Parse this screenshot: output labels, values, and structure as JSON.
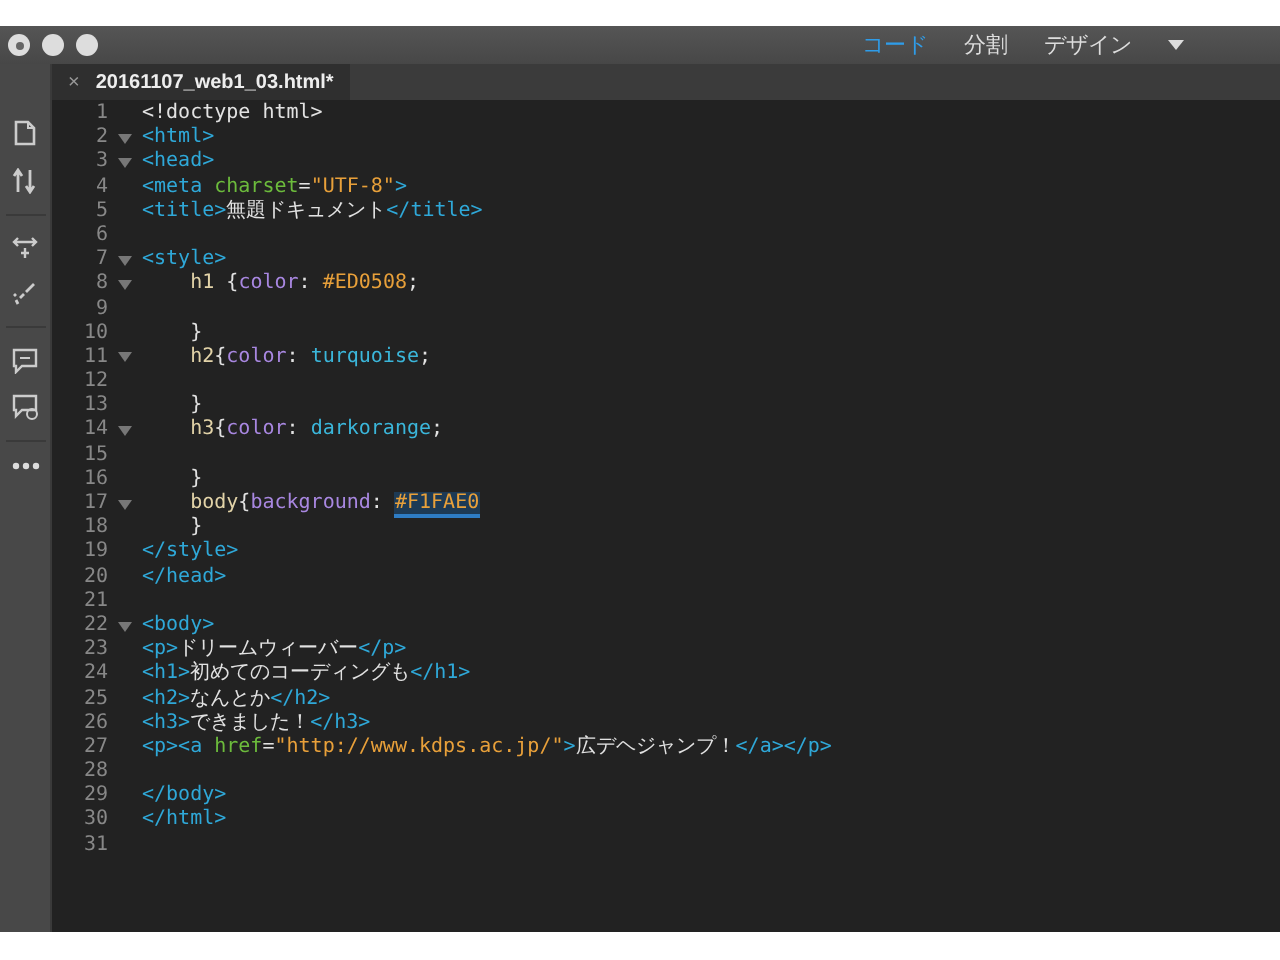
{
  "view_switcher": [
    {
      "label": "コード",
      "selected": true
    },
    {
      "label": "分割",
      "selected": false
    },
    {
      "label": "デザイン",
      "selected": false
    }
  ],
  "file_tab": {
    "close": "×",
    "title": "20161107_web1_03.html*"
  },
  "code_lines": [
    {
      "number": "1",
      "foldable": false,
      "tokens": [
        {
          "kind": "text",
          "text": "<!doctype html>"
        }
      ]
    },
    {
      "number": "2",
      "foldable": true,
      "tokens": [
        {
          "kind": "tag",
          "text": "<html>"
        }
      ]
    },
    {
      "number": "3",
      "foldable": true,
      "tokens": [
        {
          "kind": "tag",
          "text": "<head>"
        }
      ]
    },
    {
      "number": "4",
      "foldable": false,
      "tokens": [
        {
          "kind": "tag",
          "text": "<meta "
        },
        {
          "kind": "attr",
          "text": "charset"
        },
        {
          "kind": "text",
          "text": "="
        },
        {
          "kind": "string",
          "text": "\"UTF-8\""
        },
        {
          "kind": "tag",
          "text": ">"
        }
      ]
    },
    {
      "number": "5",
      "foldable": false,
      "tokens": [
        {
          "kind": "tag",
          "text": "<title>"
        },
        {
          "kind": "text",
          "text": "無題ドキュメント"
        },
        {
          "kind": "tag",
          "text": "</title>"
        }
      ]
    },
    {
      "number": "6",
      "foldable": false
    },
    {
      "number": "7",
      "foldable": true,
      "tokens": [
        {
          "kind": "tag",
          "text": "<style>"
        }
      ]
    },
    {
      "number": "8",
      "foldable": true,
      "tokens": [
        {
          "kind": "selector",
          "text": "    h1 "
        },
        {
          "kind": "text",
          "text": "{"
        },
        {
          "kind": "property",
          "text": "color"
        },
        {
          "kind": "text",
          "text": ": "
        },
        {
          "kind": "hex",
          "text": "#ED0508"
        },
        {
          "kind": "text",
          "text": ";"
        }
      ]
    },
    {
      "number": "9",
      "foldable": false
    },
    {
      "number": "10",
      "foldable": false,
      "tokens": [
        {
          "kind": "text",
          "text": "    }"
        }
      ]
    },
    {
      "number": "11",
      "foldable": true,
      "tokens": [
        {
          "kind": "selector",
          "text": "    h2"
        },
        {
          "kind": "text",
          "text": "{"
        },
        {
          "kind": "property",
          "text": "color"
        },
        {
          "kind": "text",
          "text": ": "
        },
        {
          "kind": "keyword",
          "text": "turquoise"
        },
        {
          "kind": "text",
          "text": ";"
        }
      ]
    },
    {
      "number": "12",
      "foldable": false
    },
    {
      "number": "13",
      "foldable": false,
      "tokens": [
        {
          "kind": "text",
          "text": "    }"
        }
      ]
    },
    {
      "number": "14",
      "foldable": true,
      "tokens": [
        {
          "kind": "selector",
          "text": "    h3"
        },
        {
          "kind": "text",
          "text": "{"
        },
        {
          "kind": "property",
          "text": "color"
        },
        {
          "kind": "text",
          "text": ": "
        },
        {
          "kind": "keyword",
          "text": "darkorange"
        },
        {
          "kind": "text",
          "text": ";"
        }
      ]
    },
    {
      "number": "15",
      "foldable": false
    },
    {
      "number": "16",
      "foldable": false,
      "tokens": [
        {
          "kind": "text",
          "text": "    }"
        }
      ]
    },
    {
      "number": "17",
      "foldable": true,
      "tokens": [
        {
          "kind": "selector",
          "text": "    body"
        },
        {
          "kind": "text",
          "text": "{"
        },
        {
          "kind": "property",
          "text": "background"
        },
        {
          "kind": "text",
          "text": ": "
        },
        {
          "kind": "hex-highlighted",
          "text": "#F1FAE0"
        }
      ]
    },
    {
      "number": "18",
      "foldable": false,
      "tokens": [
        {
          "kind": "text",
          "text": "    }"
        }
      ]
    },
    {
      "number": "19",
      "foldable": false,
      "tokens": [
        {
          "kind": "tag",
          "text": "</style>"
        }
      ]
    },
    {
      "number": "20",
      "foldable": false,
      "tokens": [
        {
          "kind": "tag",
          "text": "</head>"
        }
      ]
    },
    {
      "number": "21",
      "foldable": false
    },
    {
      "number": "22",
      "foldable": true,
      "tokens": [
        {
          "kind": "tag",
          "text": "<body>"
        }
      ]
    },
    {
      "number": "23",
      "foldable": false,
      "tokens": [
        {
          "kind": "tag",
          "text": "<p>"
        },
        {
          "kind": "text",
          "text": "ドリームウィーバー"
        },
        {
          "kind": "tag",
          "text": "</p>"
        }
      ]
    },
    {
      "number": "24",
      "foldable": false,
      "tokens": [
        {
          "kind": "tag",
          "text": "<h1>"
        },
        {
          "kind": "text",
          "text": "初めてのコーディングも"
        },
        {
          "kind": "tag",
          "text": "</h1>"
        }
      ]
    },
    {
      "number": "25",
      "foldable": false,
      "tokens": [
        {
          "kind": "tag",
          "text": "<h2>"
        },
        {
          "kind": "text",
          "text": "なんとか"
        },
        {
          "kind": "tag",
          "text": "</h2>"
        }
      ]
    },
    {
      "number": "26",
      "foldable": false,
      "tokens": [
        {
          "kind": "tag",
          "text": "<h3>"
        },
        {
          "kind": "text",
          "text": "できました！"
        },
        {
          "kind": "tag",
          "text": "</h3>"
        }
      ]
    },
    {
      "number": "27",
      "foldable": false,
      "tokens": [
        {
          "kind": "tag",
          "text": "<p><a "
        },
        {
          "kind": "attr",
          "text": "href"
        },
        {
          "kind": "text",
          "text": "="
        },
        {
          "kind": "string",
          "text": "\"http://www.kdps.ac.jp/\""
        },
        {
          "kind": "tag",
          "text": ">"
        },
        {
          "kind": "text",
          "text": "広デヘジャンプ！"
        },
        {
          "kind": "tag",
          "text": "</a></p>"
        }
      ]
    },
    {
      "number": "28",
      "foldable": false
    },
    {
      "number": "29",
      "foldable": false,
      "tokens": [
        {
          "kind": "tag",
          "text": "</body>"
        }
      ]
    },
    {
      "number": "30",
      "foldable": false,
      "tokens": [
        {
          "kind": "tag",
          "text": "</html>"
        }
      ]
    },
    {
      "number": "31",
      "foldable": false
    }
  ]
}
